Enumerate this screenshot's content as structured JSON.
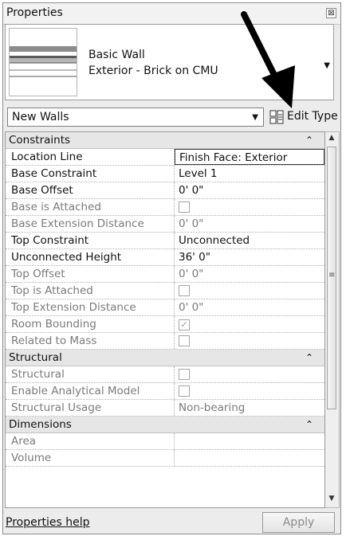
{
  "panel": {
    "title": "Properties",
    "close_glyph": "⊠"
  },
  "type_selector": {
    "family": "Basic Wall",
    "type": "Exterior - Brick on CMU",
    "dropdown_glyph": "▼"
  },
  "instance_filter": {
    "label": "New Walls",
    "dropdown_glyph": "▼"
  },
  "edit_type": {
    "label": "Edit Type",
    "icon": "edit-type-icon"
  },
  "groups": {
    "constraints": {
      "label": "Constraints",
      "collapse_glyph": "⌃"
    },
    "structural": {
      "label": "Structural",
      "collapse_glyph": "⌃"
    },
    "dimensions": {
      "label": "Dimensions",
      "collapse_glyph": "⌃"
    }
  },
  "rows": {
    "location_line": {
      "name": "Location Line",
      "value": "Finish Face: Exterior"
    },
    "base_constraint": {
      "name": "Base Constraint",
      "value": "Level 1"
    },
    "base_offset": {
      "name": "Base Offset",
      "value": "0'  0\""
    },
    "base_attached": {
      "name": "Base is Attached"
    },
    "base_ext": {
      "name": "Base Extension Distance",
      "value": "0'  0\""
    },
    "top_constraint": {
      "name": "Top Constraint",
      "value": "Unconnected"
    },
    "unconnected_height": {
      "name": "Unconnected Height",
      "value": "36'  0\""
    },
    "top_offset": {
      "name": "Top Offset",
      "value": "0'  0\""
    },
    "top_attached": {
      "name": "Top is Attached"
    },
    "top_ext": {
      "name": "Top Extension Distance",
      "value": "0'  0\""
    },
    "room_bounding": {
      "name": "Room Bounding",
      "checked": true
    },
    "related_mass": {
      "name": "Related to Mass",
      "checked": false
    },
    "structural": {
      "name": "Structural",
      "checked": false
    },
    "analytical": {
      "name": "Enable Analytical Model",
      "checked": false
    },
    "structural_usage": {
      "name": "Structural Usage",
      "value": "Non-bearing"
    },
    "area": {
      "name": "Area"
    },
    "volume": {
      "name": "Volume"
    }
  },
  "footer": {
    "help_link": "Properties help",
    "apply_label": "Apply"
  },
  "scrollbar": {
    "up_glyph": "▲",
    "down_glyph": "▼",
    "grip_glyph": "≡"
  },
  "colors": {
    "panel_bg": "#ececec",
    "group_bg": "#e6e6e6",
    "disabled_text": "#7a7a7a"
  }
}
